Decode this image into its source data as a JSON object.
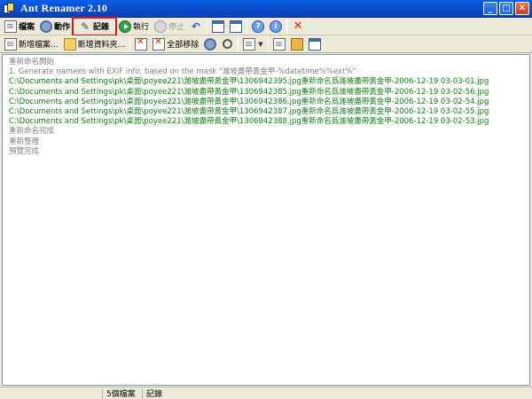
{
  "window": {
    "title": "Ant Renamer 2.10"
  },
  "toolbar1": {
    "files_label": "檔案",
    "actions_label": "動作",
    "log_label": "記錄",
    "run_label": "執行",
    "stop_label": "停止"
  },
  "toolbar2": {
    "add_files_label": "新增檔案...",
    "add_folder_label": "新增資料夾...",
    "remove_all_label": "全部移除"
  },
  "log": {
    "lines": [
      "重新命名開始",
      "1. Generate namees with EXIF info, based on the mask \"濰坡盡帶黃金甲-%datetime%%ext%\"",
      "C:\\Documents and Settings\\pk\\桌面\\poyee221\\濰坡盡帶黃金甲\\1306942395.jpg重新命名爲濰坡盡帶黃金甲-2006-12-19 03-03-01.jpg",
      "C:\\Documents and Settings\\pk\\桌面\\poyee221\\濰坡盡帶黃金甲\\1306942385.jpg重新命名爲濰坡盡帶黃金甲-2006-12-19 03-02-56.jpg",
      "C:\\Documents and Settings\\pk\\桌面\\poyee221\\濰坡盡帶黃金甲\\1306942386.jpg重新命名爲濰坡盡帶黃金甲-2006-12-19 03-02-54.jpg",
      "C:\\Documents and Settings\\pk\\桌面\\poyee221\\濰坡盡帶黃金甲\\1306942387.jpg重新命名爲濰坡盡帶黃金甲-2006-12-19 03-02-55.jpg",
      "C:\\Documents and Settings\\pk\\桌面\\poyee221\\濰坡盡帶黃金甲\\1306942388.jpg重新命名爲濰坡盡帶黃金甲-2006-12-19 03-02-53.jpg",
      "重新命名完成",
      "重新整理",
      "預覽完成"
    ]
  },
  "statusbar": {
    "file_count": "5個檔案",
    "mode": "記錄"
  },
  "colors": {
    "title_bar": "#0b4fd0",
    "success_text": "#118017",
    "info_text": "#808080",
    "highlight": "#e0141b"
  }
}
